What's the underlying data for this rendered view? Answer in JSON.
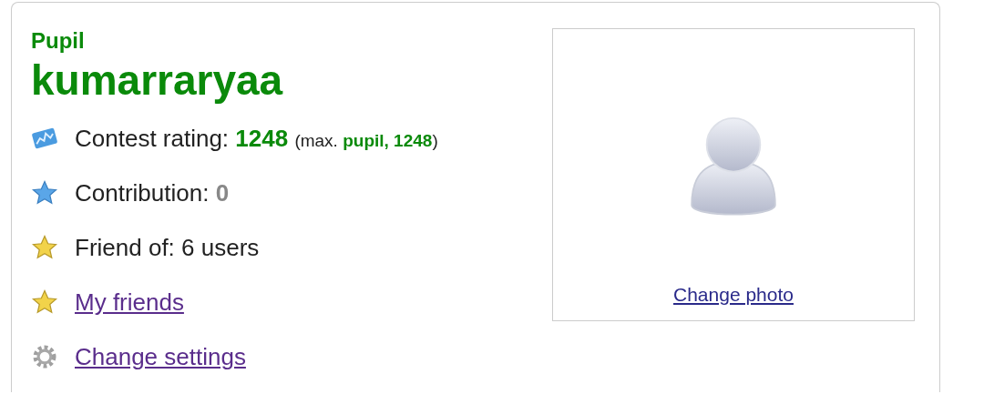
{
  "profile": {
    "rank": "Pupil",
    "handle": "kumarraryaa"
  },
  "info": [
    {
      "kind": "rating",
      "label": "Contest rating:",
      "value": "1248",
      "max_open": "(max.",
      "max_value": "pupil, 1248",
      "max_close": ")"
    },
    {
      "kind": "contribution",
      "label": "Contribution:",
      "value": "0"
    },
    {
      "kind": "friendof",
      "label": "Friend of: 6 users"
    },
    {
      "kind": "friends",
      "label": "My friends"
    },
    {
      "kind": "settings",
      "label": "Change settings"
    }
  ],
  "photo": {
    "link": "Change photo"
  }
}
